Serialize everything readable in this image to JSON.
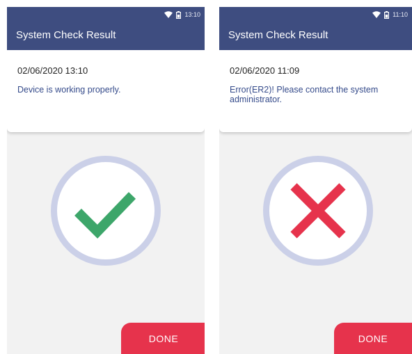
{
  "screens": [
    {
      "status": {
        "time": "13:10",
        "wifi_icon": "wifi-icon",
        "battery_icon": "battery-icon"
      },
      "app_bar": {
        "title": "System Check Result"
      },
      "card": {
        "date": "02/06/2020 13:10",
        "message": "Device is working properly."
      },
      "result": {
        "icon": "checkmark-icon",
        "color": "#3da66a",
        "ring_color": "#cbd0e8"
      },
      "done_label": "DONE"
    },
    {
      "status": {
        "time": "11:10",
        "wifi_icon": "wifi-icon",
        "battery_icon": "battery-icon"
      },
      "app_bar": {
        "title": "System Check Result"
      },
      "card": {
        "date": "02/06/2020 11:09",
        "message": "Error(ER2)! Please contact the system administrator."
      },
      "result": {
        "icon": "x-mark-icon",
        "color": "#e6334c",
        "ring_color": "#cbd0e8"
      },
      "done_label": "DONE"
    }
  ],
  "colors": {
    "app_bar": "#3e4d80",
    "done_button": "#e6334c",
    "background": "#f2f2f2"
  }
}
